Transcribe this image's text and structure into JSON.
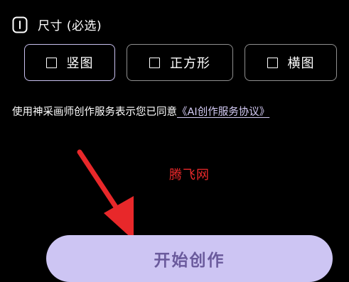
{
  "size_section": {
    "icon": "aspect-ratio-icon",
    "title": "尺寸 (必选)"
  },
  "size_options": [
    {
      "label": "竖图",
      "selected": true
    },
    {
      "label": "正方形",
      "selected": false
    },
    {
      "label": "横图",
      "selected": false
    }
  ],
  "agreement": {
    "text": "使用神采画师创作服务表示您已同意",
    "link": "《AI创作服务协议》"
  },
  "watermark": "腾飞网",
  "start_button": {
    "label": "开始创作"
  },
  "colors": {
    "background": "#000000",
    "accent": "#cdc5f3",
    "button_text": "#6a5a9c",
    "link": "#d4cbf5",
    "arrow": "#e8282a"
  }
}
